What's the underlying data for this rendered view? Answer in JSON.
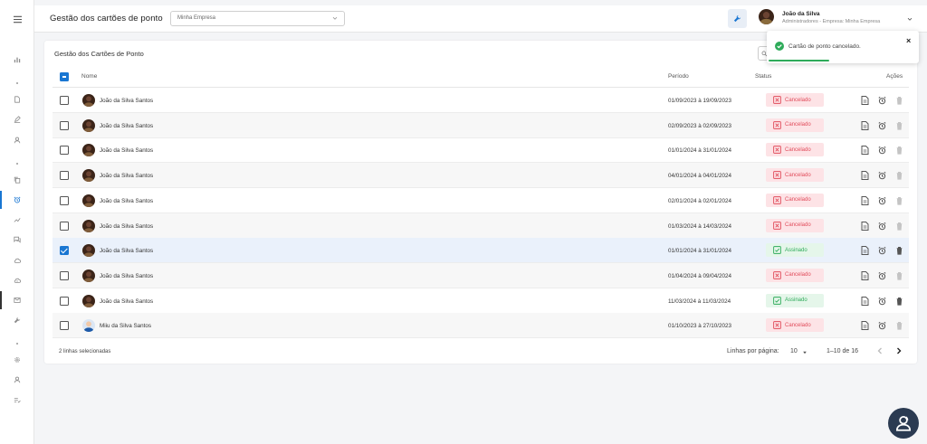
{
  "topbar": {
    "title": "Gestão dos cartões de ponto",
    "company_select": {
      "value": "Minha Empresa"
    },
    "user": {
      "name": "João da Silva",
      "role": "Administradores - Empresa: Minha Empresa"
    }
  },
  "table": {
    "title": "Gestão dos Cartões de Ponto",
    "columns": {
      "name": "Nome",
      "period": "Período",
      "status": "Status",
      "actions": "Ações"
    },
    "rows": [
      {
        "name": "João da Silva Santos",
        "period": "01/09/2023 à 19/09/2023",
        "status": "Cancelado",
        "selected": false,
        "deletable": false
      },
      {
        "name": "João da Silva Santos",
        "period": "02/09/2023 à 02/09/2023",
        "status": "Cancelado",
        "selected": false,
        "deletable": false
      },
      {
        "name": "João da Silva Santos",
        "period": "01/01/2024 à 31/01/2024",
        "status": "Cancelado",
        "selected": false,
        "deletable": false
      },
      {
        "name": "João da Silva Santos",
        "period": "04/01/2024 à 04/01/2024",
        "status": "Cancelado",
        "selected": false,
        "deletable": false
      },
      {
        "name": "João da Silva Santos",
        "period": "02/01/2024 à 02/01/2024",
        "status": "Cancelado",
        "selected": false,
        "deletable": false
      },
      {
        "name": "João da Silva Santos",
        "period": "01/03/2024 à 14/03/2024",
        "status": "Cancelado",
        "selected": false,
        "deletable": false
      },
      {
        "name": "João da Silva Santos",
        "period": "01/01/2024 à 31/01/2024",
        "status": "Assinado",
        "selected": true,
        "deletable": true
      },
      {
        "name": "João da Silva Santos",
        "period": "01/04/2024 à 09/04/2024",
        "status": "Cancelado",
        "selected": false,
        "deletable": false
      },
      {
        "name": "João da Silva Santos",
        "period": "11/03/2024 à 11/03/2024",
        "status": "Assinado",
        "selected": false,
        "deletable": true
      },
      {
        "name": "Miiu da Silva Santos",
        "period": "01/10/2023 à 27/10/2023",
        "status": "Cancelado",
        "selected": false,
        "deletable": false
      }
    ],
    "footer": {
      "selected_text": "2 linhas selecionadas",
      "rows_per_page_label": "Linhas por página:",
      "rows_per_page_value": "10",
      "range_text": "1–10 de 16"
    }
  },
  "toast": {
    "message": "Cartão de ponto cancelado.",
    "close": "×",
    "progress": 0.4
  },
  "colors": {
    "accent": "#1976d2",
    "cancel": "#e14b5a",
    "signed": "#2eab5a",
    "fab": "#2b3b52"
  },
  "icons": [
    "menu-icon",
    "wrench-icon",
    "search-icon",
    "document-icon",
    "alarm-icon",
    "trash-icon",
    "help-person-icon"
  ]
}
